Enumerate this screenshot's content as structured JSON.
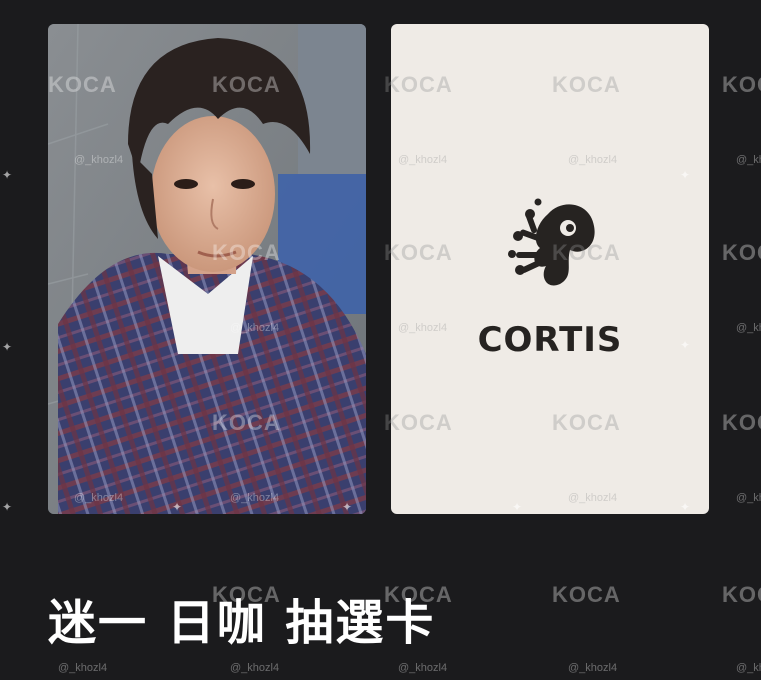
{
  "caption": "迷一 日咖 抽選卡",
  "back_card": {
    "brand_name": "CORTIS"
  },
  "watermark": {
    "brand": "KOCA",
    "handle": "@_khozl4"
  },
  "icons": {
    "logo": "cortis-splash-logo-icon",
    "sparkle": "sparkle-icon"
  }
}
